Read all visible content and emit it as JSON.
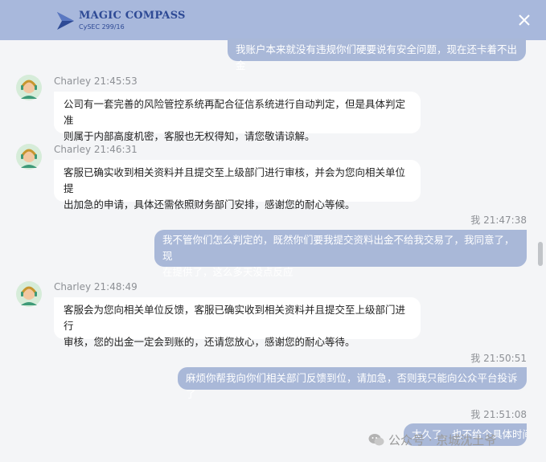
{
  "header": {
    "brand_name": "MAGIC COMPASS",
    "brand_sub": "CySEC 299/16",
    "close_icon": "close-icon",
    "colors": {
      "bar": "#a8b8dc",
      "logo": "#2e4a95"
    }
  },
  "messages": [
    {
      "sender": "me",
      "text": "我账户本来就没有违规你们硬要说有安全问题，现在还卡着不出金"
    },
    {
      "sender": "agent",
      "meta": "Charley 21:45:53",
      "lines": [
        "公司有一套完善的风险管控系统再配合征信系统进行自动判定，但是具体判定准",
        "则属于内部高度机密，客服也无权得知，请您敬请谅解。"
      ]
    },
    {
      "sender": "agent",
      "meta": "Charley 21:46:31",
      "lines": [
        "客服已确实收到相关资料并且提交至上级部门进行审核，并会为您向相关单位提",
        "出加急的申请，具体还需依照财务部门安排，感谢您的耐心等候。"
      ]
    },
    {
      "sender": "me",
      "meta": "我 21:47:38",
      "lines": [
        "我不管你们怎么判定的，既然你们要我提交资料出金不给我交易了，我同意了，现",
        "在提供了，这么多天没点反应"
      ]
    },
    {
      "sender": "agent",
      "meta": "Charley 21:48:49",
      "lines": [
        "客服会为您向相关单位反馈，客服已确实收到相关资料并且提交至上级部门进行",
        "审核，您的出金一定会到账的，还请您放心，感谢您的耐心等待。"
      ]
    },
    {
      "sender": "me",
      "meta": "我 21:50:51",
      "text": "麻烦你帮我向你们相关部门反馈到位，请加急，否则我只能向公众平台投诉了"
    },
    {
      "sender": "me",
      "meta": "我 21:51:08",
      "text": "太久了，也不给个具体时间"
    }
  ],
  "watermark": {
    "label": "公众号 · 京城沈土爷",
    "icon": "wechat-icon"
  }
}
